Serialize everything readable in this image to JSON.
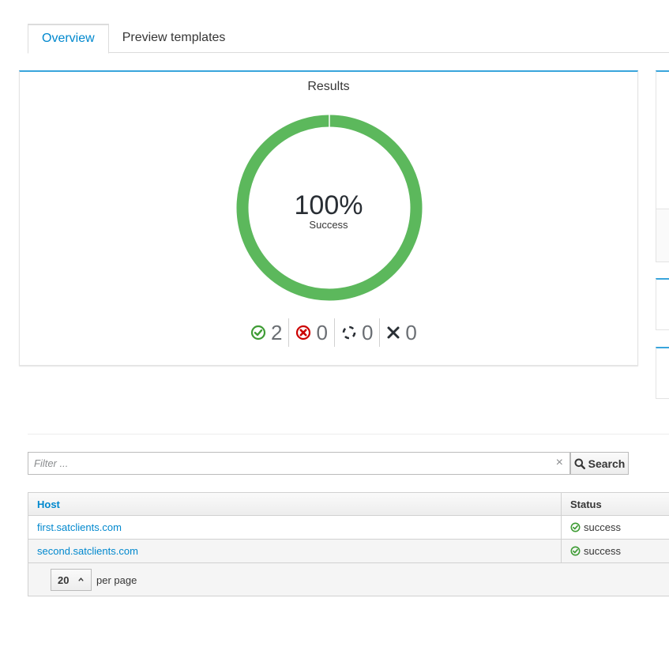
{
  "tabs": [
    {
      "label": "Overview",
      "active": true
    },
    {
      "label": "Preview templates",
      "active": false
    }
  ],
  "results": {
    "title": "Results",
    "percent": "100%",
    "subtitle": "Success",
    "success_fraction": 1.0,
    "counts": {
      "success": "2",
      "failed": "0",
      "pending": "0",
      "cancelled": "0"
    }
  },
  "filter": {
    "placeholder": "Filter ...",
    "value": "",
    "search_label": "Search"
  },
  "table": {
    "columns": [
      "Host",
      "Status"
    ],
    "rows": [
      {
        "host": "first.satclients.com",
        "status": "success"
      },
      {
        "host": "second.satclients.com",
        "status": "success"
      }
    ]
  },
  "pagination": {
    "per_page": "20",
    "per_page_label": "per page"
  },
  "colors": {
    "accent": "#0088ce",
    "success": "#5cb85c",
    "success_icon": "#3f9c35",
    "failed_icon": "#cc0000",
    "card_top": "#39a5dc"
  }
}
